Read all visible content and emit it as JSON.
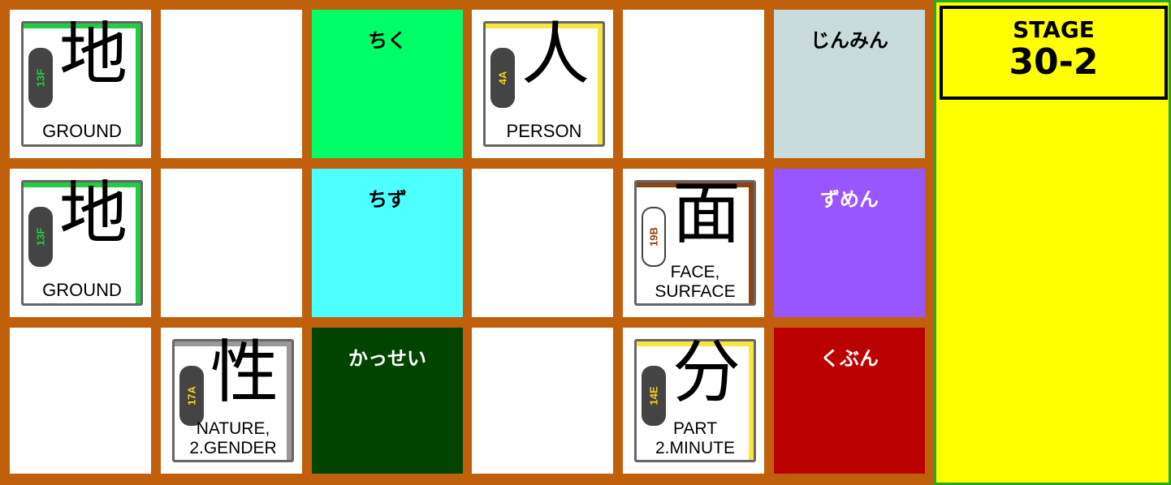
{
  "stage": {
    "label": "STAGE",
    "number": "30-2"
  },
  "colors": {
    "board": "#c0600c",
    "panel": "#ffff00",
    "panel_border": "#2aa52a"
  },
  "cells": [
    {
      "row": 0,
      "col": 0,
      "type": "kanji",
      "kanji": "地",
      "code": "13F",
      "meaning": "GROUND",
      "card_accent": "#22cc44",
      "blob": "#444",
      "code_color": "#22cc44"
    },
    {
      "row": 0,
      "col": 1,
      "type": "empty"
    },
    {
      "row": 0,
      "col": 2,
      "type": "reading",
      "reading": "ちく",
      "bg": "#00ff66",
      "color": "#000000"
    },
    {
      "row": 0,
      "col": 3,
      "type": "kanji",
      "kanji": "人",
      "code": "4A",
      "meaning": "PERSON",
      "card_accent": "#f5e642",
      "blob": "#444",
      "code_color": "#f5d020"
    },
    {
      "row": 0,
      "col": 4,
      "type": "empty"
    },
    {
      "row": 0,
      "col": 5,
      "type": "reading",
      "reading": "じんみん",
      "bg": "#c8dada",
      "color": "#000000"
    },
    {
      "row": 1,
      "col": 0,
      "type": "kanji",
      "kanji": "地",
      "code": "13F",
      "meaning": "GROUND",
      "card_accent": "#22cc44",
      "blob": "#444",
      "code_color": "#22cc44"
    },
    {
      "row": 1,
      "col": 1,
      "type": "empty"
    },
    {
      "row": 1,
      "col": 2,
      "type": "reading",
      "reading": "ちず",
      "bg": "#4dffff",
      "color": "#000000"
    },
    {
      "row": 1,
      "col": 3,
      "type": "empty"
    },
    {
      "row": 1,
      "col": 4,
      "type": "kanji",
      "kanji": "面",
      "code": "19B",
      "meaning": "FACE,\nSURFACE",
      "card_accent": "#8b4513",
      "blob": "#ffffff",
      "code_color": "#8b4513"
    },
    {
      "row": 1,
      "col": 5,
      "type": "reading",
      "reading": "ずめん",
      "bg": "#9955ff",
      "color": "#ffffff"
    },
    {
      "row": 2,
      "col": 0,
      "type": "empty"
    },
    {
      "row": 2,
      "col": 1,
      "type": "kanji",
      "kanji": "性",
      "code": "17A",
      "meaning": "NATURE,\n2.GENDER",
      "card_accent": "#999999",
      "blob": "#444",
      "code_color": "#f5d020"
    },
    {
      "row": 2,
      "col": 2,
      "type": "reading",
      "reading": "かっせい",
      "bg": "#004400",
      "color": "#ffffff"
    },
    {
      "row": 2,
      "col": 3,
      "type": "empty"
    },
    {
      "row": 2,
      "col": 4,
      "type": "kanji",
      "kanji": "分",
      "code": "14E",
      "meaning": "PART\n2.MINUTE",
      "card_accent": "#f5e642",
      "blob": "#444",
      "code_color": "#f5d020"
    },
    {
      "row": 2,
      "col": 5,
      "type": "reading",
      "reading": "くぶん",
      "bg": "#bb0000",
      "color": "#ffffff"
    }
  ]
}
